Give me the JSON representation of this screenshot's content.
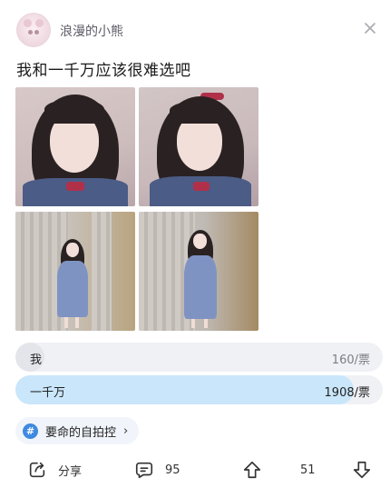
{
  "header": {
    "username": "浪漫的小熊"
  },
  "post": {
    "title": "我和一千万应该很难选吧"
  },
  "poll": {
    "options": [
      {
        "label": "我",
        "count": "160/票",
        "share": 0.08
      },
      {
        "label": "一千万",
        "count": "1908/票",
        "share": 0.92
      }
    ],
    "colors": {
      "leader": "#c9e6fb",
      "other": "#e3e5ea"
    }
  },
  "topic": {
    "name": "要命的自拍控",
    "chevron": "›",
    "icon": "hash-icon"
  },
  "actions": {
    "share_label": "分享",
    "comments": "95",
    "upvotes": "51"
  }
}
